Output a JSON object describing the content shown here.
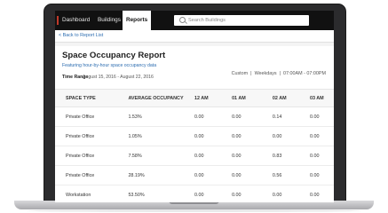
{
  "nav": {
    "items": [
      "Dashboard",
      "Buildings",
      "Reports"
    ],
    "active": "Reports",
    "search_placeholder": "Search Buildings"
  },
  "back_link": "< Back to Report List",
  "report": {
    "title": "Space Occupancy Report",
    "subtitle": "Featuring hour-by-hour space occupancy data",
    "time_range_label": "Time Range",
    "time_range_value": "August 15, 2016 - August 22, 2016",
    "options": [
      "Custom",
      "Weekdays",
      "07:00AM - 07:00PM"
    ]
  },
  "table": {
    "headers": [
      "SPACE TYPE",
      "AVERAGE OCCUPANCY",
      "12 AM",
      "01 AM",
      "02 AM",
      "03 AM"
    ],
    "rows": [
      [
        "Private Office",
        "1.53%",
        "0.00",
        "0.00",
        "0.14",
        "0.00"
      ],
      [
        "Private Office",
        "1.05%",
        "0.00",
        "0.00",
        "0.00",
        "0.00"
      ],
      [
        "Private Office",
        "7.58%",
        "0.00",
        "0.00",
        "0.83",
        "0.00"
      ],
      [
        "Private Office",
        "28.19%",
        "0.00",
        "0.00",
        "0.56",
        "0.00"
      ],
      [
        "Workstation",
        "53.50%",
        "0.00",
        "0.00",
        "0.00",
        "0.00"
      ]
    ]
  },
  "colors": {
    "nav_bg": "#111111",
    "link": "#2b6cb0",
    "laptop_frame": "#2b2b2d"
  }
}
